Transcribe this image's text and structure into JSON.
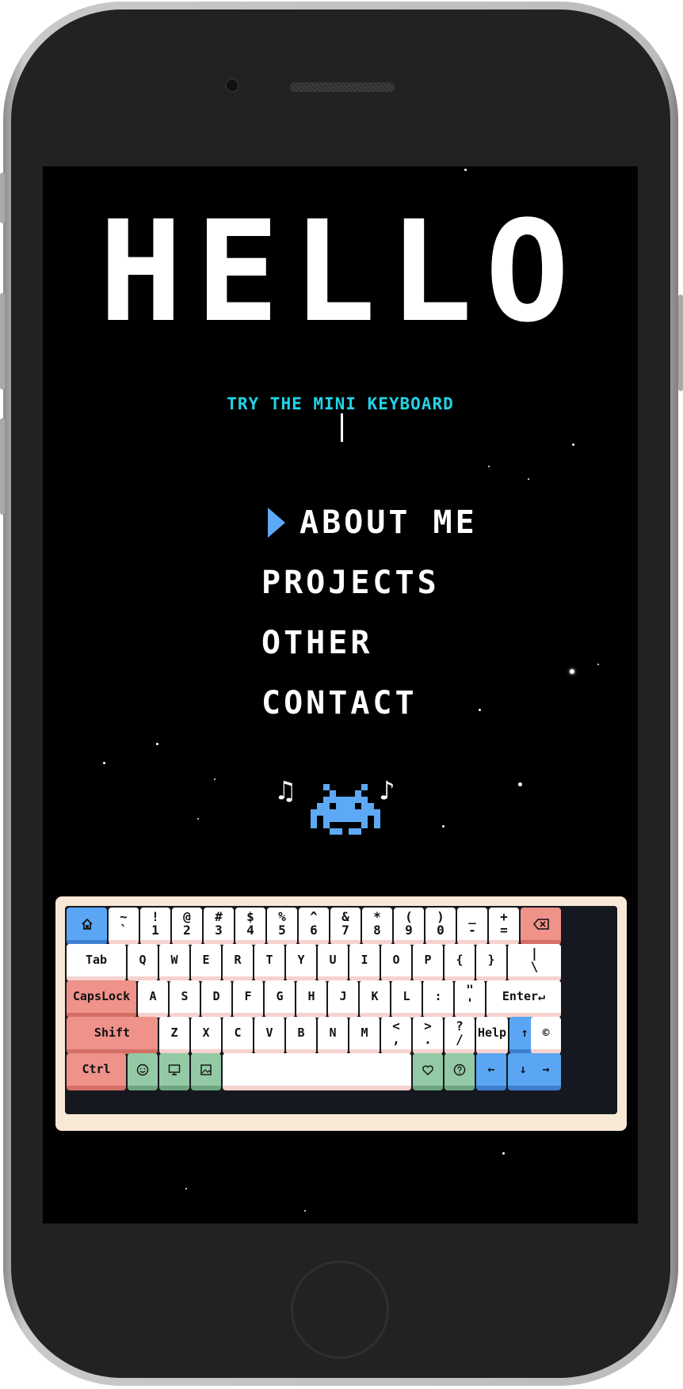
{
  "header": {
    "title": "HELLO",
    "subtitle": "TRY THE MINI KEYBOARD"
  },
  "menu": {
    "items": [
      {
        "label": "ABOUT ME",
        "active": true
      },
      {
        "label": "PROJECTS",
        "active": false
      },
      {
        "label": "OTHER",
        "active": false
      },
      {
        "label": "CONTACT",
        "active": false
      }
    ]
  },
  "music": {
    "left_note": "♫",
    "right_note": "♪"
  },
  "colors": {
    "accent_blue": "#5da9f6",
    "accent_cyan": "#21d4e6",
    "key_red": "#ee928a",
    "key_green": "#93c9a4",
    "keyboard_case": "#f8e9d7"
  },
  "keyboard": {
    "row1": [
      {
        "top": "~",
        "bot": "`"
      },
      {
        "top": "!",
        "bot": "1"
      },
      {
        "top": "@",
        "bot": "2"
      },
      {
        "top": "#",
        "bot": "3"
      },
      {
        "top": "$",
        "bot": "4"
      },
      {
        "top": "%",
        "bot": "5"
      },
      {
        "top": "^",
        "bot": "6"
      },
      {
        "top": "&",
        "bot": "7"
      },
      {
        "top": "*",
        "bot": "8"
      },
      {
        "top": "(",
        "bot": "9"
      },
      {
        "top": ")",
        "bot": "0"
      },
      {
        "top": "_",
        "bot": "-"
      },
      {
        "top": "+",
        "bot": "="
      }
    ],
    "row2": {
      "tab": "Tab",
      "letters": [
        "Q",
        "W",
        "E",
        "R",
        "T",
        "Y",
        "U",
        "I",
        "O",
        "P",
        "{",
        "}"
      ],
      "pipe": {
        "top": "|",
        "bot": "\\"
      }
    },
    "row3": {
      "capslock": "CapsLock",
      "letters": [
        "A",
        "S",
        "D",
        "F",
        "G",
        "H",
        "J",
        "K",
        "L",
        ":"
      ],
      "quote": {
        "top": "\"",
        "bot": "'"
      },
      "enter": "Enter↵"
    },
    "row4": {
      "shift": "Shift",
      "letters": [
        "Z",
        "X",
        "C",
        "V",
        "B",
        "N",
        "M"
      ],
      "punct": [
        {
          "top": "<",
          "bot": ","
        },
        {
          "top": ">",
          "bot": "."
        },
        {
          "top": "?",
          "bot": "/"
        }
      ],
      "help": "Help",
      "up": "↑",
      "copyright": "©"
    },
    "row5": {
      "ctrl": "Ctrl",
      "left": "←",
      "down": "↓",
      "right": "→"
    },
    "icons": [
      "home-icon",
      "backspace-icon",
      "smiley-icon",
      "monitor-icon",
      "image-icon",
      "heart-icon",
      "question-icon"
    ]
  }
}
